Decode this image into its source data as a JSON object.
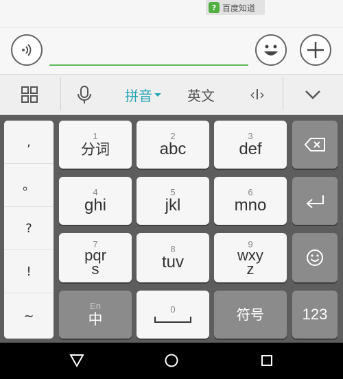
{
  "watermark": {
    "icon": "?",
    "text": "百度知道"
  },
  "chat": {
    "input_value": "",
    "input_placeholder": ""
  },
  "toolbar": {
    "pinyin": "拼音",
    "english": "英文",
    "cursor": "‹I›"
  },
  "keyboard": {
    "punctuation": [
      ",",
      "。",
      "?",
      "!",
      "~"
    ],
    "keys": {
      "k1": {
        "num": "1",
        "label": "分词"
      },
      "k2": {
        "num": "2",
        "label": "abc"
      },
      "k3": {
        "num": "3",
        "label": "def"
      },
      "k4": {
        "num": "4",
        "label": "ghi"
      },
      "k5": {
        "num": "5",
        "label": "jkl"
      },
      "k6": {
        "num": "6",
        "label": "mno"
      },
      "k7": {
        "num": "7",
        "label_top": "pqr",
        "label_bottom": "s"
      },
      "k8": {
        "num": "8",
        "label": "tuv"
      },
      "k9": {
        "num": "9",
        "label_top": "wxy",
        "label_bottom": "z"
      },
      "lang": {
        "sub": "En",
        "label": "中"
      },
      "space": {
        "num": "0"
      },
      "symbol": {
        "label": "符号"
      },
      "numbers": {
        "label": "123"
      }
    }
  },
  "colors": {
    "accent": "#26a6b4",
    "input_underline": "#5fba58",
    "keyboard_bg": "#5d5d5d",
    "key_dark": "#8b8b8b"
  },
  "icons": [
    "voice-icon",
    "emoji-icon",
    "plus-icon",
    "grid-icon",
    "microphone-icon",
    "chevron-down-icon",
    "backspace-icon",
    "enter-icon",
    "smiley-icon",
    "nav-back-icon",
    "nav-home-icon",
    "nav-recents-icon"
  ]
}
